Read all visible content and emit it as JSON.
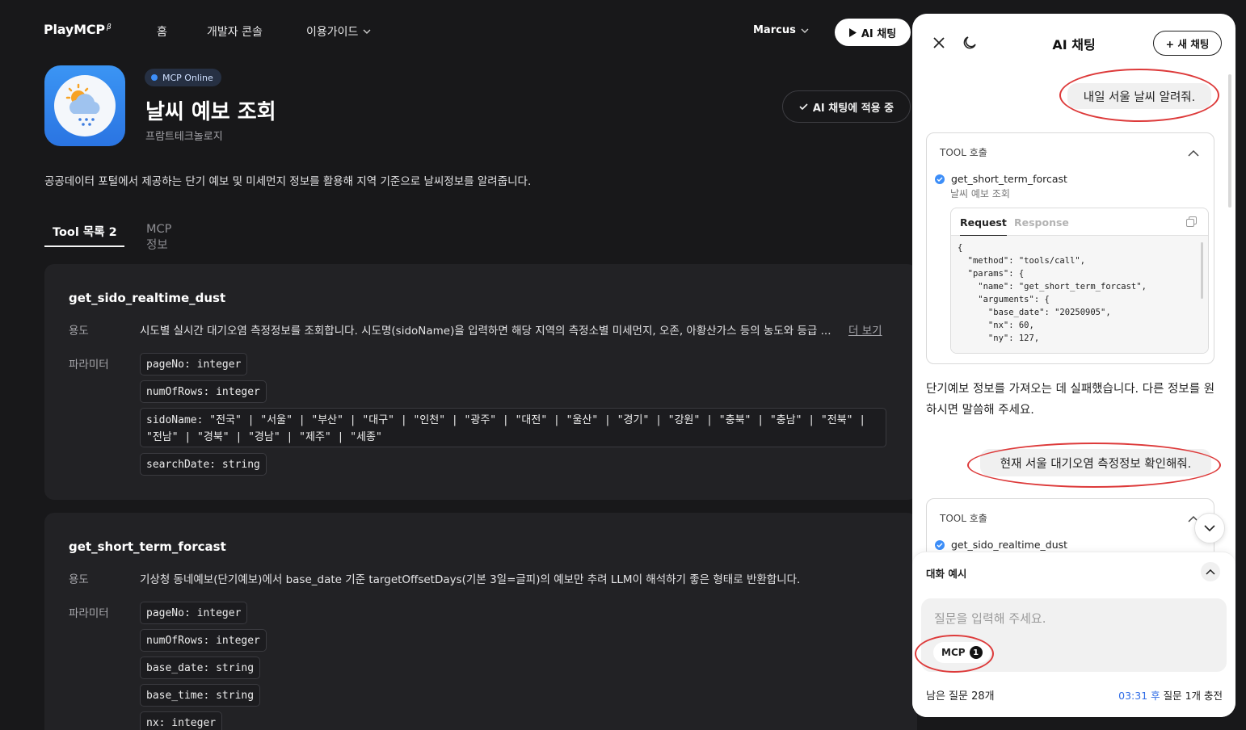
{
  "nav": {
    "logo": "PlayMCP",
    "logo_beta": "β",
    "items": [
      "홈",
      "개발자 콘솔",
      "이용가이드"
    ],
    "user": "Marcus",
    "ai_chat_button": "AI 채팅"
  },
  "header": {
    "status_badge": "MCP Online",
    "title": "날씨 예보 조회",
    "company": "프람트테크놀로지",
    "applied_button": "AI 채팅에 적용 중",
    "description": "공공데이터 포털에서 제공하는 단기 예보 및 미세먼지 정보를 활용해 지역 기준으로 날씨정보를 알려줍니다."
  },
  "tabs": [
    {
      "label": "Tool 목록 2",
      "active": true
    },
    {
      "label": "MCP 정보",
      "active": false
    }
  ],
  "labels": {
    "usage": "용도",
    "params": "파라미터",
    "more": "더 보기"
  },
  "tools": [
    {
      "name": "get_sido_realtime_dust",
      "usage": "시도별 실시간 대기오염 측정정보를 조회합니다. 시도명(sidoName)을 입력하면 해당 지역의 측정소별 미세먼지, 오존, 아황산가스 등의 농도와 등급 ...",
      "params": [
        "pageNo: integer",
        "numOfRows: integer",
        "sidoName: \"전국\" | \"서울\" | \"부산\" | \"대구\" | \"인천\" | \"광주\" | \"대전\" | \"울산\" | \"경기\" | \"강원\" | \"충북\" | \"충남\" | \"전북\" |",
        "\"전남\" | \"경북\" | \"경남\" | \"제주\" | \"세종\"",
        "searchDate: string"
      ]
    },
    {
      "name": "get_short_term_forcast",
      "usage": "기상청 동네예보(단기예보)에서 base_date 기준 targetOffsetDays(기본 3일=글피)의 예보만 추려 LLM이 해석하기 좋은 형태로 반환합니다.",
      "params": [
        "pageNo: integer",
        "numOfRows: integer",
        "base_date: string",
        "base_time: string",
        "nx: integer"
      ]
    }
  ],
  "chat": {
    "title": "AI 채팅",
    "new_chat": "+ 새 채팅",
    "messages": {
      "user1": "내일 서울 날씨 알려줘.",
      "tool_call_title": "TOOL 호출",
      "tool1_name": "get_short_term_forcast",
      "tool1_mcp": "날씨 예보 조회",
      "request_tab": "Request",
      "response_tab": "Response",
      "code_lines": [
        "{",
        "  \"method\": \"tools/call\",",
        "  \"params\": {",
        "    \"name\": \"get_short_term_forcast\",",
        "    \"arguments\": {",
        "      \"base_date\": \"20250905\",",
        "      \"nx\": 60,",
        "      \"ny\": 127,"
      ],
      "bot1": "단기예보 정보를 가져오는 데 실패했습니다. 다른 정보를 원하시면 말씀해 주세요.",
      "user2": "현재 서울 대기오염 측정정보 확인해줘.",
      "tool2_name": "get_sido_realtime_dust"
    },
    "examples_label": "대화 예시",
    "input_placeholder": "질문을 입력해 주세요.",
    "mcp_chip": "MCP",
    "mcp_count": "1",
    "remaining": "남은 질문 28개",
    "recharge_time": "03:31 후",
    "recharge_text": " 질문 1개 충전"
  }
}
